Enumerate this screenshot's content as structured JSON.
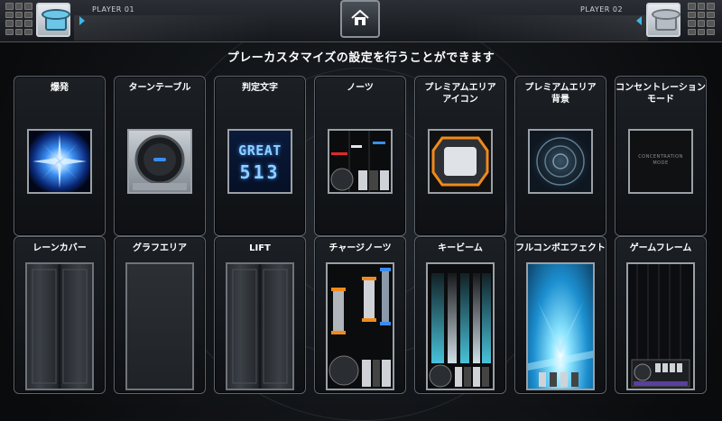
{
  "header": {
    "player1_label": "PLAYER 01",
    "player2_label": "PLAYER 02",
    "home_icon": "home-icon"
  },
  "subtitle": "プレーカスタマイズの設定を行うことができます",
  "thumb_texts": {
    "great": "GREAT",
    "combo": "513",
    "concentration": "CONCENTRATION MODE"
  },
  "colors": {
    "accent_blue": "#3a8df0",
    "accent_cyan": "#4fd6f0",
    "accent_orange": "#f08a1c",
    "accent_red": "#e0282a"
  },
  "cards_row1": [
    {
      "label": "爆発"
    },
    {
      "label": "ターンテーブル"
    },
    {
      "label": "判定文字"
    },
    {
      "label": "ノーツ"
    },
    {
      "label": "プレミアムエリア\nアイコン"
    },
    {
      "label": "プレミアムエリア\n背景"
    },
    {
      "label": "コンセントレーション\nモード"
    }
  ],
  "cards_row2": [
    {
      "label": "レーンカバー"
    },
    {
      "label": "グラフエリア"
    },
    {
      "label": "LIFT"
    },
    {
      "label": "チャージノーツ"
    },
    {
      "label": "キービーム"
    },
    {
      "label": "フルコンボエフェクト"
    },
    {
      "label": "ゲームフレーム"
    }
  ]
}
